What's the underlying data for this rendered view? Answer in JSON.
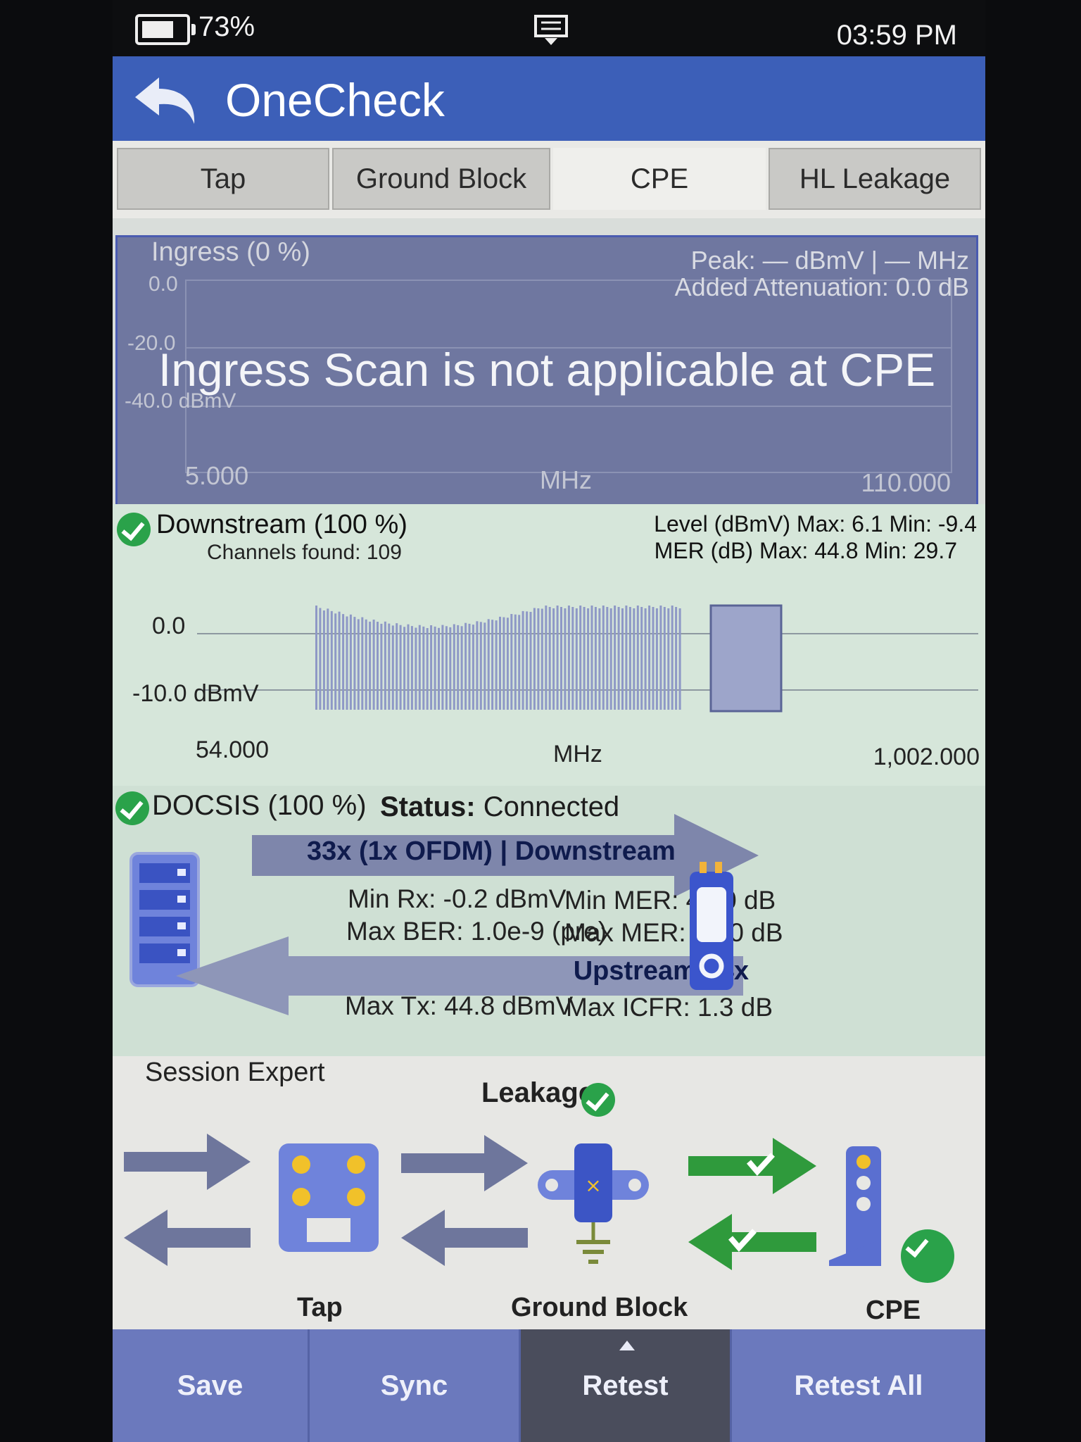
{
  "status_bar": {
    "battery": "73%",
    "time": "03:59 PM"
  },
  "app": {
    "title": "OneCheck"
  },
  "tabs": [
    {
      "label": "Tap"
    },
    {
      "label": "Ground Block"
    },
    {
      "label": "CPE"
    },
    {
      "label": "HL Leakage"
    }
  ],
  "ingress": {
    "title": "Ingress (0 %)",
    "peak": "Peak: — dBmV | — MHz",
    "attenuation": "Added Attenuation: 0.0 dB",
    "y_top": "0.0",
    "y_mid": "-20.0",
    "y_bottom": "-40.0 dBmV",
    "x_start": "5.000",
    "x_unit": "MHz",
    "x_end": "110.000",
    "message": "Ingress Scan is not applicable at CPE"
  },
  "downstream": {
    "title": "Downstream (100 %)",
    "channels": "Channels found: 109",
    "level": "Level (dBmV) Max: 6.1  Min: -9.4",
    "mer": "MER (dB) Max: 44.8  Min: 29.7",
    "y_top": "0.0",
    "y_bottom": "-10.0 dBmV",
    "x_start": "54.000",
    "x_unit": "MHz",
    "x_end": "1,002.000"
  },
  "docsis": {
    "title": "DOCSIS (100 %)",
    "status_label": "Status:",
    "status_value": "Connected",
    "downstream_label": "33x (1x OFDM) | Downstream",
    "min_rx": "Min Rx: -0.2 dBmV",
    "min_mer": "Min MER: 42.0 dB",
    "max_ber": "Max BER: 1.0e-9 (pre)",
    "max_mer": "Max MER: 44.0 dB",
    "upstream_label": "Upstream | 4x",
    "max_tx": "Max Tx: 44.8 dBmV",
    "max_icfr": "Max ICFR: 1.3 dB"
  },
  "session": {
    "title": "Session Expert",
    "leakage": "Leakage",
    "tap": "Tap",
    "ground_block": "Ground Block",
    "cpe": "CPE"
  },
  "toolbar": {
    "save": "Save",
    "sync": "Sync",
    "retest": "Retest",
    "retest_all": "Retest All"
  },
  "colors": {
    "app_bar": "#3c5fb8",
    "ok_green": "#2aa24a",
    "device_blue": "#5a6fd0"
  }
}
